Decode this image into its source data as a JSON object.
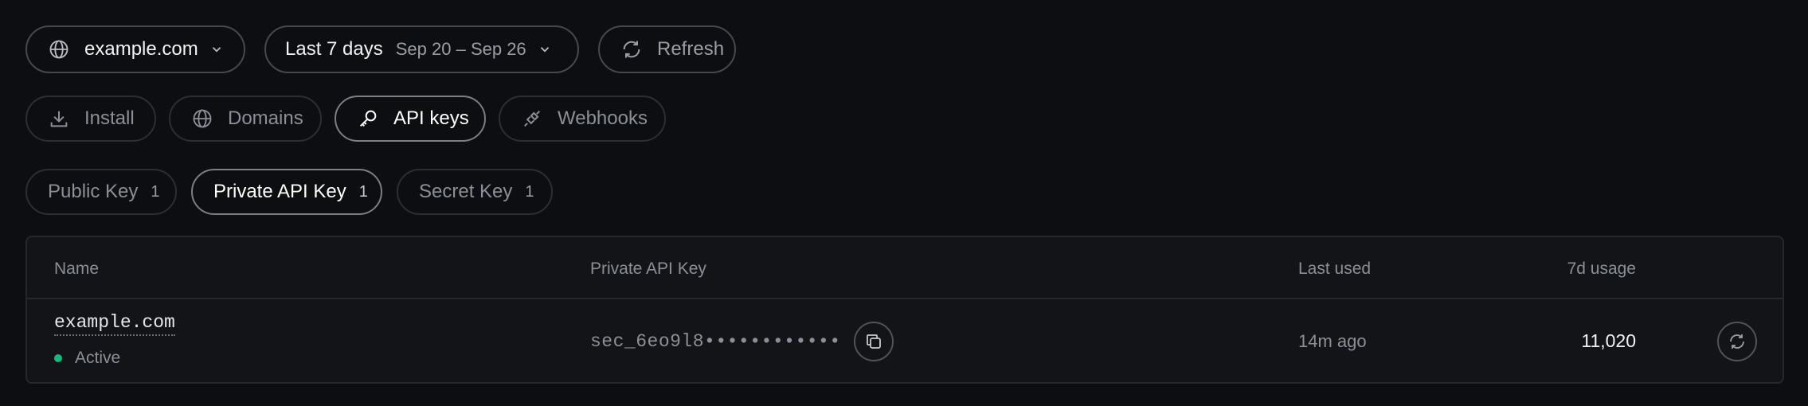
{
  "toolbar": {
    "domain_label": "example.com",
    "range_label": "Last 7 days",
    "range_dates": "Sep 20 – Sep 26",
    "refresh_label": "Refresh"
  },
  "nav_tabs": [
    {
      "label": "Install",
      "icon": "download-icon"
    },
    {
      "label": "Domains",
      "icon": "globe-icon"
    },
    {
      "label": "API keys",
      "icon": "key-icon",
      "active": true
    },
    {
      "label": "Webhooks",
      "icon": "plug-icon"
    }
  ],
  "key_tabs": [
    {
      "label": "Public Key",
      "count": "1"
    },
    {
      "label": "Private API Key",
      "count": "1",
      "active": true
    },
    {
      "label": "Secret Key",
      "count": "1"
    }
  ],
  "table": {
    "columns": [
      "Name",
      "Private API Key",
      "Last used",
      "7d usage"
    ],
    "rows": [
      {
        "name": "example.com",
        "status": "Active",
        "key": "sec_6eo9l8••••••••••••",
        "last_used": "14m ago",
        "usage": "11,020"
      }
    ]
  },
  "colors": {
    "background": "#0d0e11",
    "active_dot": "#10b981"
  }
}
